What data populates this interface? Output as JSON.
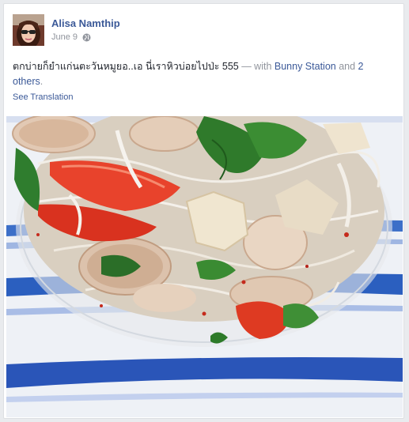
{
  "post": {
    "author_name": "Alisa Namthip",
    "date": "June 9",
    "privacy_icon": "globe-icon",
    "text_main": "ตกบ่ายก็ยำแก่นตะวันหมูยอ..เอ นี่เราหิวบ่อยไปป่ะ 555",
    "text_with": " — with ",
    "tagged_person": "Bunny Station",
    "text_and": " and ",
    "tagged_others": "2 others",
    "text_end": ".",
    "see_translation": "See Translation"
  },
  "colors": {
    "link": "#3b5998",
    "muted": "#90949c",
    "text": "#1d2129",
    "tablecloth_stripe": "#2b5fbf"
  }
}
